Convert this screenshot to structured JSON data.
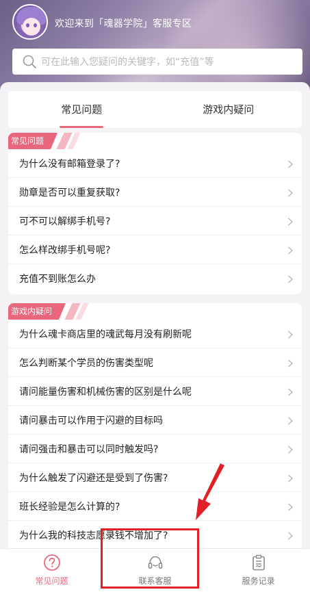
{
  "header": {
    "welcome_text": "欢迎来到「魂器学院」客服专区"
  },
  "search": {
    "placeholder": "可在此输入您疑问的关键字，如“充值”等"
  },
  "tabs": [
    {
      "label": "常见问题",
      "active": true
    },
    {
      "label": "游戏内疑问",
      "active": false
    }
  ],
  "section_common": {
    "tag": "常见问题",
    "items": [
      "为什么没有邮箱登录了?",
      "勋章是否可以重复获取?",
      "可不可以解绑手机号?",
      "怎么样改绑手机号呢?",
      "充值不到账怎么办"
    ]
  },
  "section_ingame": {
    "tag": "游戏内疑问",
    "items": [
      "为什么魂卡商店里的魂武每月没有刷新呢",
      "怎么判断某个学员的伤害类型呢",
      "请问能量伤害和机械伤害的区别是什么呢",
      "请问暴击可以作用于闪避的目标吗",
      "请问强击和暴击可以同时触发吗?",
      "为什么触发了闪避还是受到了伤害?",
      "班长经验是怎么计算的?",
      "为什么我的科技志愿录钱不增加了?"
    ]
  },
  "bottom_nav": [
    {
      "label": "常见问题",
      "icon": "question-circle-icon",
      "active": true
    },
    {
      "label": "联系客服",
      "icon": "headset-icon",
      "active": false
    },
    {
      "label": "服务记录",
      "icon": "clipboard-icon",
      "active": false
    }
  ],
  "colors": {
    "accent": "#e8677c",
    "annotation": "#e01f26"
  }
}
